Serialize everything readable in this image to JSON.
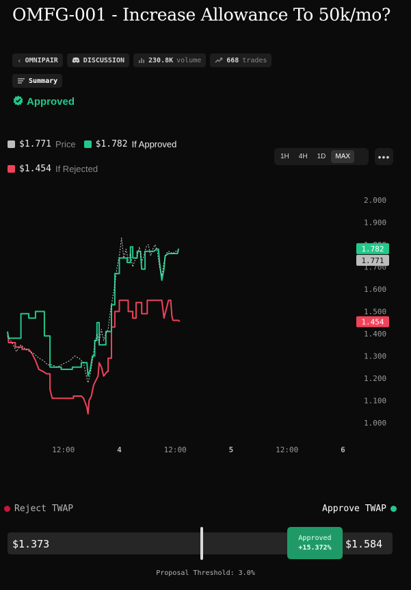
{
  "title": "OMFG-001 - Increase Allowance To 50k/mo?",
  "chips": {
    "omnipair": "OMNIPAIR",
    "discussion": "DISCUSSION",
    "volume_value": "230.8K",
    "volume_label": "volume",
    "trades_value": "668",
    "trades_label": "trades"
  },
  "summary_label": "Summary",
  "status": "Approved",
  "legend": {
    "price_value": "$1.771",
    "price_label": "Price",
    "approved_value": "$1.782",
    "approved_label": "If Approved",
    "rejected_value": "$1.454",
    "rejected_label": "If Rejected"
  },
  "timeframes": [
    "1H",
    "4H",
    "1D",
    "MAX"
  ],
  "active_timeframe": "MAX",
  "more_label": "•••",
  "colors": {
    "approved": "#22c98b",
    "rejected": "#f0435a",
    "price": "#bdbdbd",
    "accent_pill": "#1f9a67"
  },
  "chart_data": {
    "type": "line",
    "title": "",
    "xlabel": "",
    "ylabel": "",
    "ylim": [
      1.0,
      2.0
    ],
    "yticks": [
      1.0,
      1.1,
      1.2,
      1.3,
      1.4,
      1.5,
      1.6,
      1.7,
      1.8,
      1.9,
      2.0
    ],
    "xticks": [
      {
        "x": 0.5,
        "label": "12:00"
      },
      {
        "x": 1.0,
        "label": "4"
      },
      {
        "x": 1.5,
        "label": "12:00"
      },
      {
        "x": 2.0,
        "label": "5"
      },
      {
        "x": 2.5,
        "label": "12:00"
      },
      {
        "x": 3.0,
        "label": "6"
      }
    ],
    "xlim": [
      0.0,
      3.12
    ],
    "series": [
      {
        "name": "If Approved",
        "style": "solid",
        "end_label": "1.782",
        "points": [
          [
            0.0,
            1.41
          ],
          [
            0.01,
            1.38
          ],
          [
            0.12,
            1.38
          ],
          [
            0.12,
            1.49
          ],
          [
            0.19,
            1.49
          ],
          [
            0.19,
            1.47
          ],
          [
            0.25,
            1.47
          ],
          [
            0.25,
            1.5
          ],
          [
            0.33,
            1.5
          ],
          [
            0.33,
            1.39
          ],
          [
            0.38,
            1.39
          ],
          [
            0.38,
            1.25
          ],
          [
            0.48,
            1.25
          ],
          [
            0.48,
            1.24
          ],
          [
            0.58,
            1.24
          ],
          [
            0.58,
            1.25
          ],
          [
            0.66,
            1.25
          ],
          [
            0.66,
            1.27
          ],
          [
            0.71,
            1.27
          ],
          [
            0.72,
            1.21
          ],
          [
            0.74,
            1.24
          ],
          [
            0.76,
            1.3
          ],
          [
            0.78,
            1.3
          ],
          [
            0.78,
            1.37
          ],
          [
            0.8,
            1.37
          ],
          [
            0.8,
            1.45
          ],
          [
            0.82,
            1.45
          ],
          [
            0.82,
            1.35
          ],
          [
            0.88,
            1.35
          ],
          [
            0.88,
            1.41
          ],
          [
            0.93,
            1.41
          ],
          [
            0.93,
            1.53
          ],
          [
            0.96,
            1.53
          ],
          [
            0.96,
            1.67
          ],
          [
            1.0,
            1.67
          ],
          [
            1.0,
            1.74
          ],
          [
            1.07,
            1.74
          ],
          [
            1.07,
            1.72
          ],
          [
            1.1,
            1.72
          ],
          [
            1.1,
            1.79
          ],
          [
            1.12,
            1.79
          ],
          [
            1.12,
            1.74
          ],
          [
            1.16,
            1.74
          ],
          [
            1.16,
            1.77
          ],
          [
            1.19,
            1.77
          ],
          [
            1.2,
            1.69
          ],
          [
            1.23,
            1.69
          ],
          [
            1.23,
            1.77
          ],
          [
            1.31,
            1.77
          ],
          [
            1.33,
            1.78
          ],
          [
            1.35,
            1.78
          ],
          [
            1.36,
            1.72
          ],
          [
            1.38,
            1.64
          ],
          [
            1.4,
            1.69
          ],
          [
            1.41,
            1.75
          ],
          [
            1.44,
            1.76
          ],
          [
            1.52,
            1.76
          ],
          [
            1.53,
            1.782
          ]
        ]
      },
      {
        "name": "If Rejected",
        "style": "solid",
        "end_label": "1.454",
        "points": [
          [
            0.0,
            1.41
          ],
          [
            0.01,
            1.36
          ],
          [
            0.07,
            1.36
          ],
          [
            0.07,
            1.34
          ],
          [
            0.13,
            1.34
          ],
          [
            0.13,
            1.33
          ],
          [
            0.19,
            1.33
          ],
          [
            0.22,
            1.31
          ],
          [
            0.25,
            1.28
          ],
          [
            0.28,
            1.24
          ],
          [
            0.32,
            1.23
          ],
          [
            0.35,
            1.22
          ],
          [
            0.38,
            1.22
          ],
          [
            0.38,
            1.15
          ],
          [
            0.4,
            1.11
          ],
          [
            0.59,
            1.11
          ],
          [
            0.59,
            1.12
          ],
          [
            0.66,
            1.12
          ],
          [
            0.68,
            1.11
          ],
          [
            0.71,
            1.07
          ],
          [
            0.72,
            1.04
          ],
          [
            0.73,
            1.1
          ],
          [
            0.75,
            1.12
          ],
          [
            0.77,
            1.17
          ],
          [
            0.81,
            1.21
          ],
          [
            0.82,
            1.27
          ],
          [
            0.84,
            1.25
          ],
          [
            0.86,
            1.21
          ],
          [
            0.89,
            1.23
          ],
          [
            0.9,
            1.23
          ],
          [
            0.9,
            1.29
          ],
          [
            0.93,
            1.29
          ],
          [
            0.93,
            1.43
          ],
          [
            0.96,
            1.43
          ],
          [
            0.96,
            1.5
          ],
          [
            1.0,
            1.5
          ],
          [
            1.0,
            1.55
          ],
          [
            1.08,
            1.55
          ],
          [
            1.08,
            1.5
          ],
          [
            1.12,
            1.5
          ],
          [
            1.12,
            1.47
          ],
          [
            1.15,
            1.47
          ],
          [
            1.15,
            1.54
          ],
          [
            1.2,
            1.54
          ],
          [
            1.2,
            1.49
          ],
          [
            1.25,
            1.49
          ],
          [
            1.25,
            1.55
          ],
          [
            1.38,
            1.55
          ],
          [
            1.4,
            1.47
          ],
          [
            1.42,
            1.51
          ],
          [
            1.44,
            1.55
          ],
          [
            1.46,
            1.55
          ],
          [
            1.47,
            1.48
          ],
          [
            1.48,
            1.46
          ],
          [
            1.53,
            1.46
          ],
          [
            1.54,
            1.454
          ]
        ]
      },
      {
        "name": "Price",
        "style": "dashed",
        "end_label": "1.771",
        "points": [
          [
            0.0,
            1.39
          ],
          [
            0.04,
            1.36
          ],
          [
            0.08,
            1.32
          ],
          [
            0.12,
            1.35
          ],
          [
            0.16,
            1.33
          ],
          [
            0.2,
            1.32
          ],
          [
            0.24,
            1.31
          ],
          [
            0.28,
            1.29
          ],
          [
            0.32,
            1.28
          ],
          [
            0.36,
            1.26
          ],
          [
            0.4,
            1.26
          ],
          [
            0.44,
            1.25
          ],
          [
            0.48,
            1.26
          ],
          [
            0.52,
            1.27
          ],
          [
            0.56,
            1.28
          ],
          [
            0.6,
            1.3
          ],
          [
            0.64,
            1.29
          ],
          [
            0.68,
            1.27
          ],
          [
            0.7,
            1.22
          ],
          [
            0.72,
            1.18
          ],
          [
            0.74,
            1.22
          ],
          [
            0.76,
            1.28
          ],
          [
            0.78,
            1.35
          ],
          [
            0.8,
            1.4
          ],
          [
            0.82,
            1.36
          ],
          [
            0.84,
            1.42
          ],
          [
            0.86,
            1.37
          ],
          [
            0.88,
            1.4
          ],
          [
            0.9,
            1.42
          ],
          [
            0.92,
            1.5
          ],
          [
            0.94,
            1.56
          ],
          [
            0.96,
            1.62
          ],
          [
            0.98,
            1.7
          ],
          [
            1.0,
            1.75
          ],
          [
            1.02,
            1.83
          ],
          [
            1.04,
            1.74
          ],
          [
            1.06,
            1.78
          ],
          [
            1.08,
            1.73
          ],
          [
            1.1,
            1.76
          ],
          [
            1.12,
            1.7
          ],
          [
            1.14,
            1.73
          ],
          [
            1.16,
            1.75
          ],
          [
            1.18,
            1.79
          ],
          [
            1.2,
            1.72
          ],
          [
            1.22,
            1.75
          ],
          [
            1.24,
            1.79
          ],
          [
            1.26,
            1.8
          ],
          [
            1.28,
            1.75
          ],
          [
            1.3,
            1.78
          ],
          [
            1.32,
            1.8
          ],
          [
            1.34,
            1.77
          ],
          [
            1.36,
            1.7
          ],
          [
            1.38,
            1.66
          ],
          [
            1.4,
            1.72
          ],
          [
            1.42,
            1.76
          ],
          [
            1.44,
            1.77
          ],
          [
            1.48,
            1.76
          ],
          [
            1.5,
            1.77
          ],
          [
            1.53,
            1.771
          ]
        ]
      }
    ]
  },
  "twap": {
    "reject_label": "Reject TWAP",
    "approve_label": "Approve TWAP",
    "reject_value": "$1.373",
    "approve_value": "$1.584",
    "pill_status": "Approved",
    "pill_delta": "+15.372%",
    "threshold": "Proposal Threshold: 3.0%"
  }
}
